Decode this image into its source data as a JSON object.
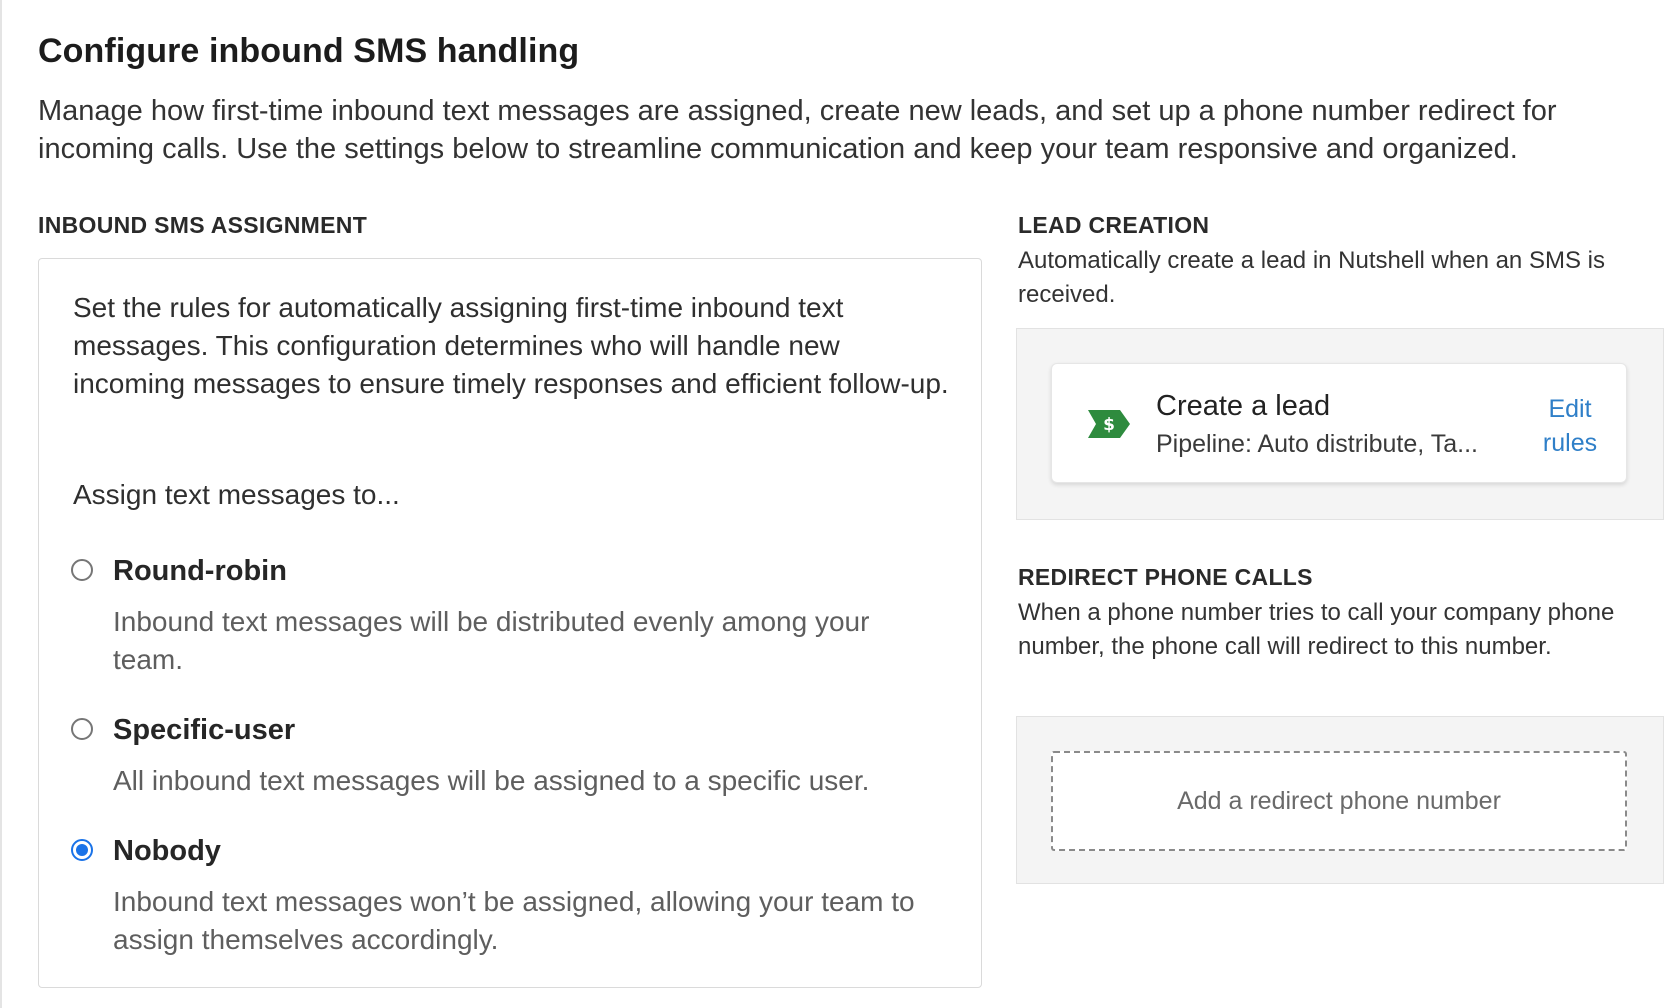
{
  "header": {
    "title": "Configure inbound SMS handling",
    "description": "Manage how first-time inbound text messages are assigned, create new leads, and set up a phone number redirect for incoming calls. Use the settings below to streamline communication and keep your team responsive and organized."
  },
  "assignment": {
    "label": "INBOUND SMS ASSIGNMENT",
    "description": "Set the rules for automatically assigning first-time inbound text messages. This configuration determines who will handle new incoming messages to ensure timely responses and efficient follow-up.",
    "prompt": "Assign text messages to...",
    "selected": "nobody",
    "options": [
      {
        "id": "round-robin",
        "title": "Round-robin",
        "description": "Inbound text messages will be distributed evenly among your team."
      },
      {
        "id": "specific-user",
        "title": "Specific-user",
        "description": "All inbound text messages will be assigned to a specific user."
      },
      {
        "id": "nobody",
        "title": "Nobody",
        "description": "Inbound text messages won’t be assigned, allowing your team to assign themselves accordingly."
      }
    ]
  },
  "lead_creation": {
    "label": "LEAD CREATION",
    "description": "Automatically create a lead in Nutshell when an SMS is received.",
    "card": {
      "icon": "dollar-tag-icon",
      "icon_glyph": "$",
      "title": "Create a lead",
      "subtitle": "Pipeline: Auto distribute, Ta...",
      "action": "Edit rules"
    }
  },
  "redirect": {
    "label": "REDIRECT PHONE CALLS",
    "description": "When a phone number tries to call your company phone number, the phone call will redirect to this number.",
    "button": "Add a redirect phone number"
  },
  "colors": {
    "accent_blue": "#1a73e8",
    "link_blue": "#2f7fc8",
    "icon_green": "#2e8b3e",
    "panel_gray": "#f4f4f4"
  }
}
